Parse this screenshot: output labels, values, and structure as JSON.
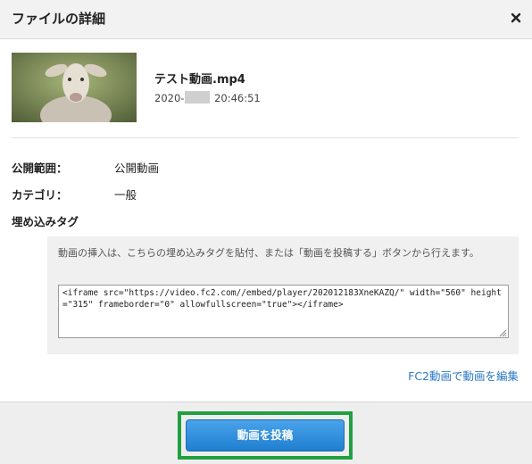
{
  "header": {
    "title": "ファイルの詳細",
    "close_icon": "close-icon"
  },
  "file": {
    "name": "テスト動画.mp4",
    "date_prefix": "2020-",
    "date_suffix": " 20:46:51"
  },
  "details": {
    "visibility_label": "公開範囲：",
    "visibility_value": "公開動画",
    "category_label": "カテゴリ：",
    "category_value": "一般"
  },
  "embed": {
    "heading": "埋め込みタグ",
    "description": "動画の挿入は、こちらの埋め込みタグを貼付、または「動画を投稿する」ボタンから行えます。",
    "code": "<iframe src=\"https://video.fc2.com//embed/player/202012183XneKAZQ/\" width=\"560\" height=\"315\" frameborder=\"0\" allowfullscreen=\"true\"></iframe>"
  },
  "edit_link": "FC2動画で動画を編集",
  "footer": {
    "post_button": "動画を投稿",
    "highlight_color": "#20a040"
  },
  "colors": {
    "accent": "#2a78c6",
    "button": "#1f7fd0"
  }
}
